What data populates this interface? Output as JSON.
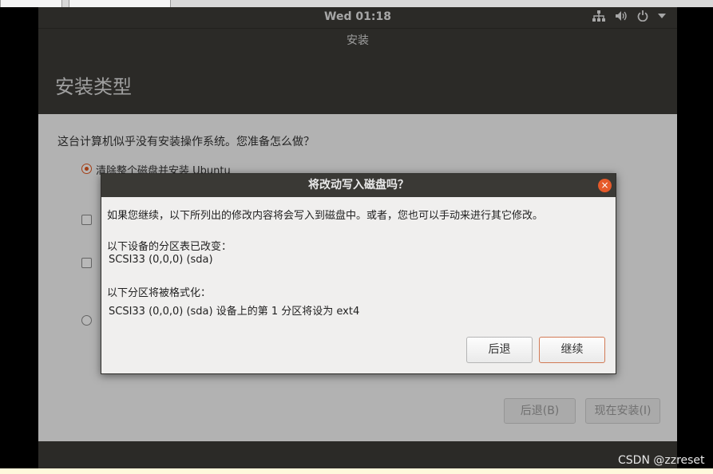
{
  "topbar": {
    "clock": "Wed 01:18",
    "icons": [
      "network-icon",
      "volume-icon",
      "power-icon",
      "menu-arrow-icon"
    ]
  },
  "window": {
    "title": "安装"
  },
  "page": {
    "heading": "安装类型",
    "question": "这台计算机似乎没有安装操作系统。您准备怎么做？",
    "options": [
      {
        "label": "清除整个磁盘并安装 Ubuntu",
        "selected": true
      }
    ],
    "buttons": {
      "back": "后退(B)",
      "install": "现在安装(I)"
    }
  },
  "dialog": {
    "title": "将改动写入磁盘吗？",
    "intro": "如果您继续，以下所列出的修改内容将会写入到磁盘中。或者，您也可以手动来进行其它修改。",
    "partition_table_heading": "以下设备的分区表已改变：",
    "partition_table_device": "SCSI33 (0,0,0) (sda)",
    "format_heading": "以下分区将被格式化：",
    "format_detail": "SCSI33 (0,0,0) (sda) 设备上的第 1 分区将设为 ext4",
    "back_button": "后退",
    "continue_button": "继续"
  },
  "watermark": "CSDN @zzreset",
  "colors": {
    "accent": "#e2581f",
    "panel": "#3c3b37"
  }
}
